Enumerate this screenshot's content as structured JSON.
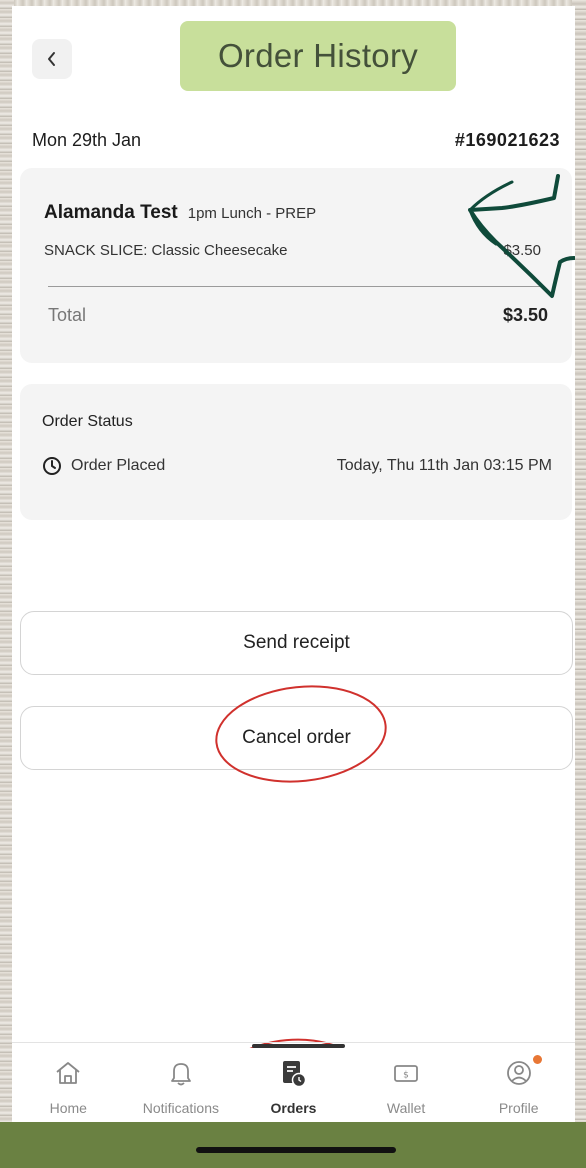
{
  "header": {
    "back_icon": "chevron-left-icon",
    "title": "Order History"
  },
  "order": {
    "date": "Mon 29th Jan",
    "number": "#169021623",
    "shop_name": "Alamanda Test",
    "shop_meta": "1pm Lunch - PREP",
    "items": [
      {
        "name": "SNACK SLICE: Classic Cheesecake",
        "price": "$3.50"
      }
    ],
    "total_label": "Total",
    "total_value": "$3.50"
  },
  "status": {
    "title": "Order Status",
    "state": "Order Placed",
    "state_icon": "clock-icon",
    "timestamp": "Today, Thu 11th Jan 03:15 PM"
  },
  "actions": {
    "send_receipt": "Send receipt",
    "cancel_order": "Cancel order"
  },
  "nav": {
    "items": [
      {
        "label": "Home",
        "icon": "home-icon"
      },
      {
        "label": "Notifications",
        "icon": "bell-icon"
      },
      {
        "label": "Orders",
        "icon": "receipt-clock-icon",
        "active": true
      },
      {
        "label": "Wallet",
        "icon": "wallet-icon"
      },
      {
        "label": "Profile",
        "icon": "profile-icon"
      }
    ]
  },
  "colors": {
    "title_pill": "#c8df9b",
    "annotation_arrow": "#0f4a3a",
    "annotation_circle": "#d0312d",
    "notification_dot": "#e87735",
    "bottom_bar": "#6a8142"
  }
}
